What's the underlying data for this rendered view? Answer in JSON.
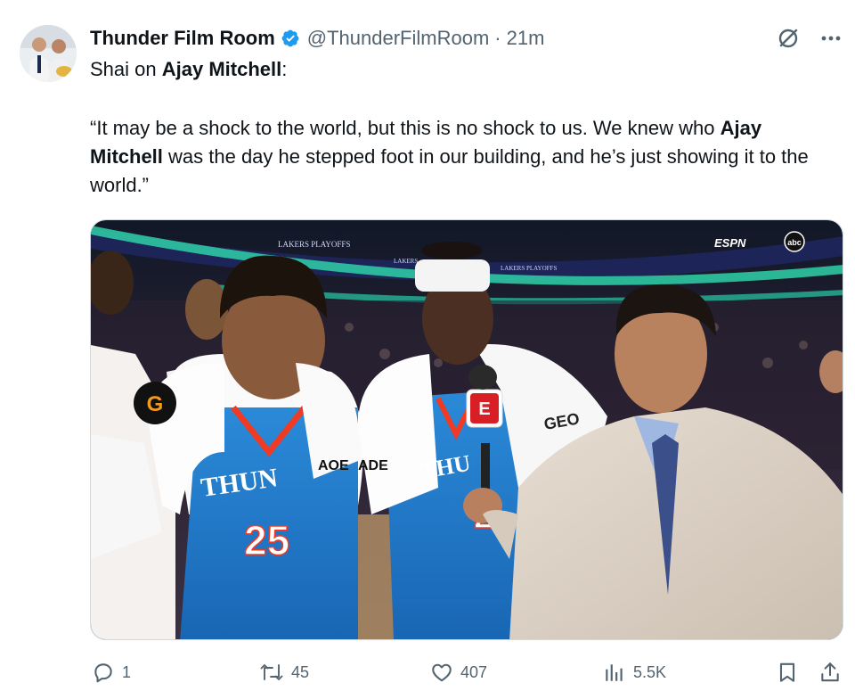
{
  "author": {
    "display_name": "Thunder Film Room",
    "handle": "@ThunderFilmRoom",
    "separator": "·",
    "time": "21m"
  },
  "post": {
    "line1_prefix": "Shai on ",
    "line1_bold": "Ajay Mitchell",
    "line1_suffix": ":",
    "quote_1": "“It may be a shock to the world, but this is no shock to us. We knew who ",
    "quote_bold": "Ajay Mitchell",
    "quote_2": " was the day he stepped foot in our building, and he’s just showing it to the world.”"
  },
  "media": {
    "banner_1": "LAKERS PLAYOFFS",
    "banner_2": "LAKERS",
    "banner_3": "LAKERS PLAYOFFS",
    "network": "ESPN",
    "network_2": "abc",
    "mic_flag": "E",
    "jersey_text": "THUN",
    "jersey_number": "25",
    "jersey_number_2": "2",
    "towel_text_1": "GEO",
    "towel_text_2": "ADE",
    "towel_text_3": "AOE"
  },
  "actions": {
    "replies": "1",
    "reposts": "45",
    "likes": "407",
    "views": "5.5K"
  },
  "colors": {
    "text": "#0f1419",
    "secondary": "#536471",
    "verified": "#1d9bf0",
    "thunder_blue": "#1f7fd1",
    "thunder_orange": "#ef3b24"
  },
  "icons": {
    "verified": "verified-badge-icon",
    "grok": "grok-icon",
    "more": "more-icon",
    "reply": "reply-icon",
    "repost": "repost-icon",
    "like": "heart-icon",
    "views": "views-icon",
    "bookmark": "bookmark-icon",
    "share": "share-icon"
  }
}
